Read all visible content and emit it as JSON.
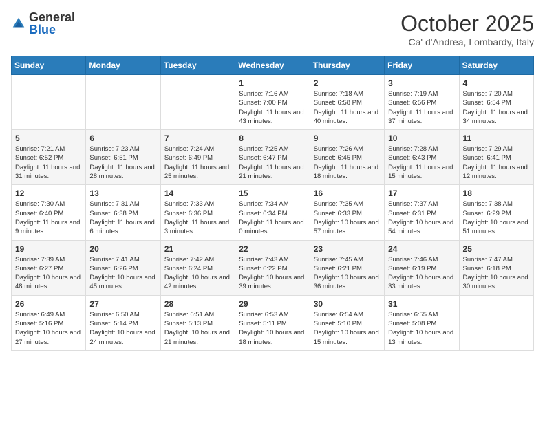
{
  "logo": {
    "general": "General",
    "blue": "Blue"
  },
  "title": "October 2025",
  "subtitle": "Ca' d'Andrea, Lombardy, Italy",
  "weekdays": [
    "Sunday",
    "Monday",
    "Tuesday",
    "Wednesday",
    "Thursday",
    "Friday",
    "Saturday"
  ],
  "weeks": [
    [
      {
        "day": "",
        "info": ""
      },
      {
        "day": "",
        "info": ""
      },
      {
        "day": "",
        "info": ""
      },
      {
        "day": "1",
        "info": "Sunrise: 7:16 AM\nSunset: 7:00 PM\nDaylight: 11 hours and 43 minutes."
      },
      {
        "day": "2",
        "info": "Sunrise: 7:18 AM\nSunset: 6:58 PM\nDaylight: 11 hours and 40 minutes."
      },
      {
        "day": "3",
        "info": "Sunrise: 7:19 AM\nSunset: 6:56 PM\nDaylight: 11 hours and 37 minutes."
      },
      {
        "day": "4",
        "info": "Sunrise: 7:20 AM\nSunset: 6:54 PM\nDaylight: 11 hours and 34 minutes."
      }
    ],
    [
      {
        "day": "5",
        "info": "Sunrise: 7:21 AM\nSunset: 6:52 PM\nDaylight: 11 hours and 31 minutes."
      },
      {
        "day": "6",
        "info": "Sunrise: 7:23 AM\nSunset: 6:51 PM\nDaylight: 11 hours and 28 minutes."
      },
      {
        "day": "7",
        "info": "Sunrise: 7:24 AM\nSunset: 6:49 PM\nDaylight: 11 hours and 25 minutes."
      },
      {
        "day": "8",
        "info": "Sunrise: 7:25 AM\nSunset: 6:47 PM\nDaylight: 11 hours and 21 minutes."
      },
      {
        "day": "9",
        "info": "Sunrise: 7:26 AM\nSunset: 6:45 PM\nDaylight: 11 hours and 18 minutes."
      },
      {
        "day": "10",
        "info": "Sunrise: 7:28 AM\nSunset: 6:43 PM\nDaylight: 11 hours and 15 minutes."
      },
      {
        "day": "11",
        "info": "Sunrise: 7:29 AM\nSunset: 6:41 PM\nDaylight: 11 hours and 12 minutes."
      }
    ],
    [
      {
        "day": "12",
        "info": "Sunrise: 7:30 AM\nSunset: 6:40 PM\nDaylight: 11 hours and 9 minutes."
      },
      {
        "day": "13",
        "info": "Sunrise: 7:31 AM\nSunset: 6:38 PM\nDaylight: 11 hours and 6 minutes."
      },
      {
        "day": "14",
        "info": "Sunrise: 7:33 AM\nSunset: 6:36 PM\nDaylight: 11 hours and 3 minutes."
      },
      {
        "day": "15",
        "info": "Sunrise: 7:34 AM\nSunset: 6:34 PM\nDaylight: 11 hours and 0 minutes."
      },
      {
        "day": "16",
        "info": "Sunrise: 7:35 AM\nSunset: 6:33 PM\nDaylight: 10 hours and 57 minutes."
      },
      {
        "day": "17",
        "info": "Sunrise: 7:37 AM\nSunset: 6:31 PM\nDaylight: 10 hours and 54 minutes."
      },
      {
        "day": "18",
        "info": "Sunrise: 7:38 AM\nSunset: 6:29 PM\nDaylight: 10 hours and 51 minutes."
      }
    ],
    [
      {
        "day": "19",
        "info": "Sunrise: 7:39 AM\nSunset: 6:27 PM\nDaylight: 10 hours and 48 minutes."
      },
      {
        "day": "20",
        "info": "Sunrise: 7:41 AM\nSunset: 6:26 PM\nDaylight: 10 hours and 45 minutes."
      },
      {
        "day": "21",
        "info": "Sunrise: 7:42 AM\nSunset: 6:24 PM\nDaylight: 10 hours and 42 minutes."
      },
      {
        "day": "22",
        "info": "Sunrise: 7:43 AM\nSunset: 6:22 PM\nDaylight: 10 hours and 39 minutes."
      },
      {
        "day": "23",
        "info": "Sunrise: 7:45 AM\nSunset: 6:21 PM\nDaylight: 10 hours and 36 minutes."
      },
      {
        "day": "24",
        "info": "Sunrise: 7:46 AM\nSunset: 6:19 PM\nDaylight: 10 hours and 33 minutes."
      },
      {
        "day": "25",
        "info": "Sunrise: 7:47 AM\nSunset: 6:18 PM\nDaylight: 10 hours and 30 minutes."
      }
    ],
    [
      {
        "day": "26",
        "info": "Sunrise: 6:49 AM\nSunset: 5:16 PM\nDaylight: 10 hours and 27 minutes."
      },
      {
        "day": "27",
        "info": "Sunrise: 6:50 AM\nSunset: 5:14 PM\nDaylight: 10 hours and 24 minutes."
      },
      {
        "day": "28",
        "info": "Sunrise: 6:51 AM\nSunset: 5:13 PM\nDaylight: 10 hours and 21 minutes."
      },
      {
        "day": "29",
        "info": "Sunrise: 6:53 AM\nSunset: 5:11 PM\nDaylight: 10 hours and 18 minutes."
      },
      {
        "day": "30",
        "info": "Sunrise: 6:54 AM\nSunset: 5:10 PM\nDaylight: 10 hours and 15 minutes."
      },
      {
        "day": "31",
        "info": "Sunrise: 6:55 AM\nSunset: 5:08 PM\nDaylight: 10 hours and 13 minutes."
      },
      {
        "day": "",
        "info": ""
      }
    ]
  ]
}
